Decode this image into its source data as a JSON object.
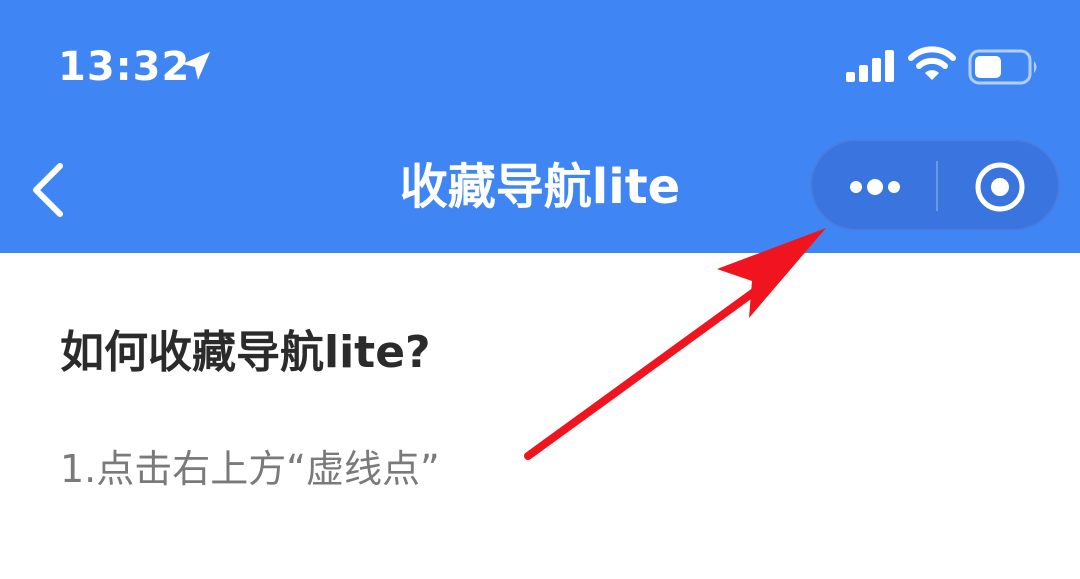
{
  "status_bar": {
    "time": "13:32",
    "icons": [
      "location-arrow-icon",
      "cellular-signal-icon",
      "wifi-icon",
      "battery-icon"
    ]
  },
  "nav_bar": {
    "title": "收藏导航lite",
    "back_icon": "chevron-left-icon",
    "capsule_icons": [
      "more-dots-icon",
      "close-target-icon"
    ]
  },
  "content": {
    "heading": "如何收藏导航lite?",
    "step_1": "1.点击右上方“虚线点”"
  },
  "annotation": {
    "arrow_color": "#f0141e",
    "arrow_icon": "red-arrow-icon"
  },
  "colors": {
    "header_bg": "#3f86f4",
    "capsule_bg": "#3a74de",
    "heading_text": "#2b2b2b",
    "body_text": "#7a7a7a"
  }
}
